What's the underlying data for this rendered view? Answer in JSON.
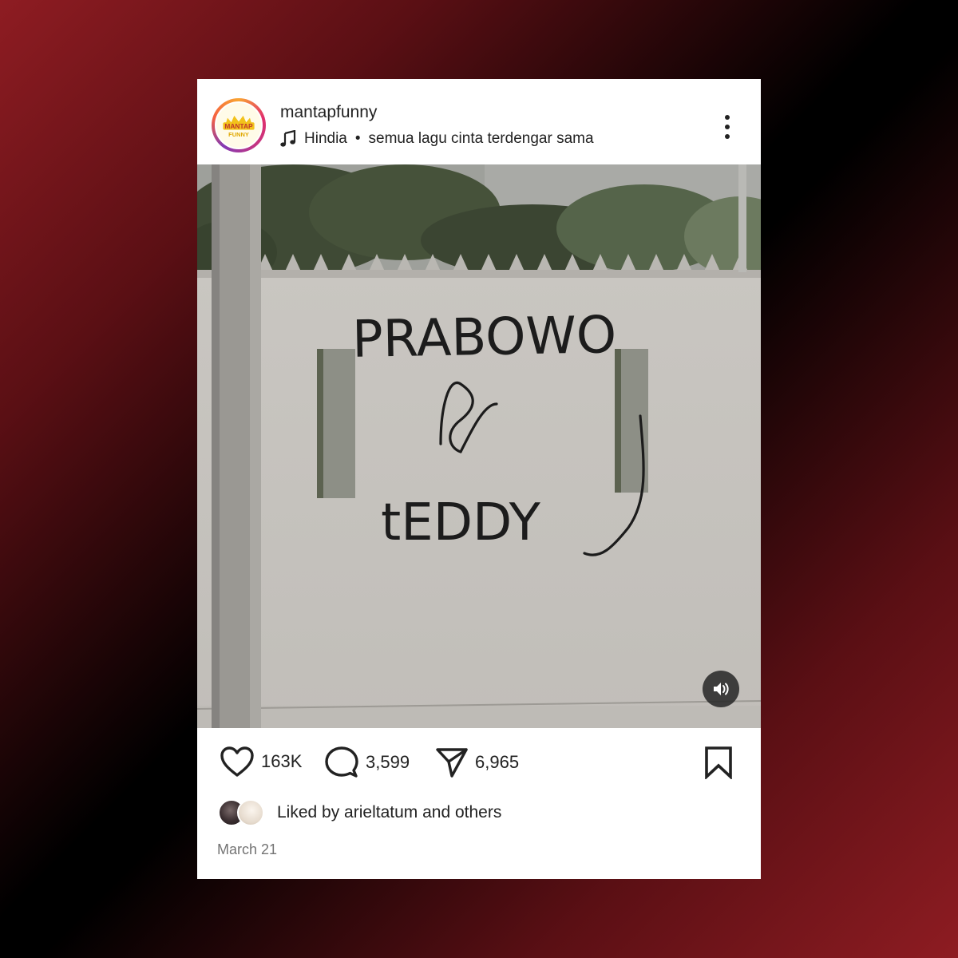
{
  "post": {
    "username": "mantapfunny",
    "music": {
      "artist": "Hindia",
      "separator": "•",
      "song": "semua lagu cinta terdengar sama"
    },
    "image": {
      "graffiti": {
        "line1": "PRABOWO",
        "line3": "tEDDY"
      }
    },
    "actions": {
      "likes": "163K",
      "comments": "3,599",
      "shares": "6,965"
    },
    "liked_by": "Liked by arieltatum and others",
    "date": "March 21"
  },
  "logo": {
    "text_top": "MANTAP",
    "text_bottom": "FUNNY"
  },
  "colors": {
    "background_red": "#8e1c22",
    "text": "#222222",
    "muted": "#737373"
  },
  "icons": [
    "music-note-icon",
    "more-options-icon",
    "speaker-icon",
    "heart-icon",
    "comment-icon",
    "share-icon",
    "bookmark-icon"
  ]
}
